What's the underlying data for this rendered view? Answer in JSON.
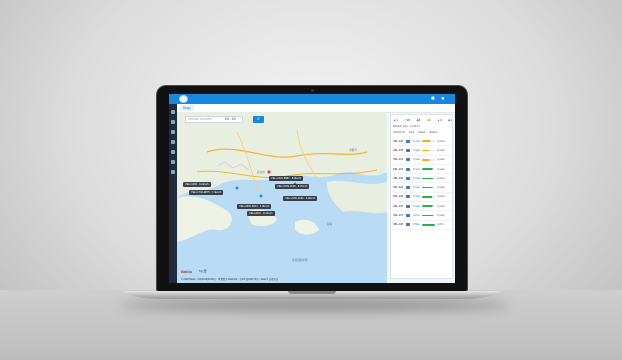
{
  "app": {
    "tabs": [
      {
        "label": "Map"
      }
    ],
    "colors": {
      "primary": "#1787e0",
      "sidebar": "#1f2a3a"
    }
  },
  "search": {
    "placeholder": "Vehicle number",
    "time": "00 : 00",
    "button_icon": "search-icon"
  },
  "topbar": {
    "icons": [
      "message-icon",
      "user-icon"
    ]
  },
  "sidebar": {
    "icons": [
      "home-icon",
      "map-icon",
      "truck-icon",
      "list-icon",
      "chart-icon",
      "settings-icon",
      "user-icon"
    ]
  },
  "summary": {
    "counts": [
      {
        "icon": "alert-icon",
        "value": "4"
      },
      {
        "icon": "vehicle-icon",
        "value": "96"
      },
      {
        "icon": "running-icon",
        "value": "8"
      },
      {
        "icon": "parked-icon",
        "value": "6"
      },
      {
        "icon": "warning-icon",
        "value": "3"
      },
      {
        "icon": "offline-icon",
        "value": "1"
      }
    ],
    "refresh_text": "Refresh time : 12:30:17"
  },
  "table": {
    "columns": [
      "Vehicle ID",
      "Type",
      "Status",
      "Battery"
    ],
    "rows": [
      {
        "id": "SBL-208",
        "status": "Travel",
        "level": "Quality",
        "color": "#f5b301",
        "fill": 0.62
      },
      {
        "id": "SBL-208",
        "status": "Travel",
        "level": "Quality",
        "color": "#f5b301",
        "fill": 0.55
      },
      {
        "id": "SBL-203",
        "status": "Travel",
        "level": "Quality",
        "color": "#f5b301",
        "fill": 0.58
      },
      {
        "id": "SBL-206",
        "status": "Travel",
        "level": "Quality",
        "color": "#22b34a",
        "fill": 0.8
      },
      {
        "id": "SBL-208",
        "status": "Travel",
        "level": "Quality",
        "color": "#22b34a",
        "fill": 0.85
      },
      {
        "id": "SBL-205",
        "status": "Travel",
        "level": "Quality",
        "color": "#22b34a",
        "fill": 0.82
      },
      {
        "id": "SBL-208",
        "status": "Travel",
        "level": "Quality",
        "color": "#22b34a",
        "fill": 0.78
      },
      {
        "id": "SBL-202",
        "status": "Travel",
        "level": "Quality",
        "color": "#22b34a",
        "fill": 0.8
      },
      {
        "id": "SBL-207",
        "status": "Arrive",
        "level": "Quality",
        "color": "#22b34a",
        "fill": 0.83
      },
      {
        "id": "SBL-208",
        "status": "Office",
        "level": "100%",
        "color": "#22b34a",
        "fill": 1.0
      }
    ]
  },
  "map": {
    "district": "武汉市",
    "markers": [
      {
        "label": "VEH-2231-8587 · 8.9km/h"
      },
      {
        "label": "VEH-2103-2018 · 8.7km/h"
      },
      {
        "label": "VEH-1402 · 9.2km/h"
      },
      {
        "label": "VEH-1702-9875 · 7.4km/h"
      },
      {
        "label": "VEH-2150-3102 · 6.9km/h"
      },
      {
        "label": "VEH-1830-6604 · 7.9km/h"
      },
      {
        "label": "VEH-2001 · 8.4km/h"
      }
    ],
    "sea_labels": [
      "南海",
      "香港国际机场",
      "大鹏湾"
    ],
    "logo_main": "Bai",
    "logo_suffix": "du",
    "scale": "5公里",
    "copyright": "© 2020 Baidu - GS(2019)5218号 - 甲测资字11111342 - 京ICP证030173号 - Data © 长地万方"
  }
}
